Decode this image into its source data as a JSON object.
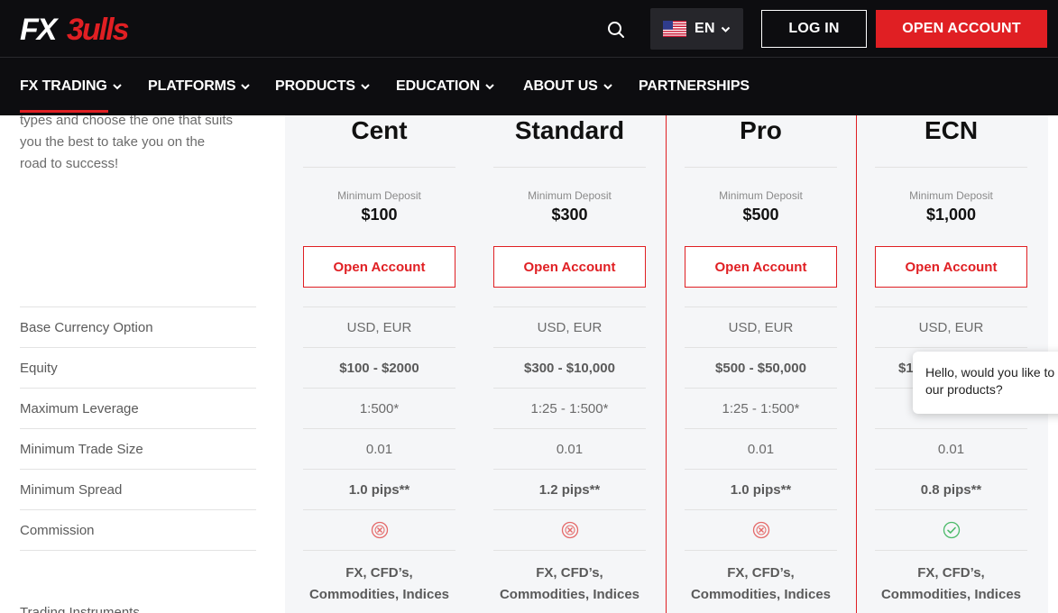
{
  "header": {
    "logo_text": "FX3ulls",
    "lang_code": "EN",
    "login_label": "LOG IN",
    "open_account_label": "OPEN ACCOUNT",
    "brand_color": "#e01f23"
  },
  "nav": {
    "items": [
      {
        "label": "FX TRADING"
      },
      {
        "label": "PLATFORMS"
      },
      {
        "label": "PRODUCTS"
      },
      {
        "label": "EDUCATION"
      },
      {
        "label": "ABOUT US"
      },
      {
        "label": "PARTNERSHIPS"
      }
    ]
  },
  "intro": {
    "line1": "types and choose the one that suits",
    "line2": "you the best to take you on the",
    "line3": "road to success!"
  },
  "rows": [
    {
      "label": "Base Currency Option"
    },
    {
      "label": "Equity"
    },
    {
      "label": "Maximum Leverage"
    },
    {
      "label": "Minimum Trade Size"
    },
    {
      "label": "Minimum Spread"
    },
    {
      "label": "Commission"
    },
    {
      "label": "Trading Instruments"
    }
  ],
  "accounts": [
    {
      "name": "Cent",
      "min_deposit_label": "Minimum Deposit",
      "min_deposit": "$100",
      "button": "Open Account",
      "currency": "USD, EUR",
      "equity": "$100 - $2000",
      "leverage": "1:500*",
      "trade_size": "0.01",
      "spread": "1.0 pips**",
      "commission_icon": "cross-icon",
      "instruments_1": "FX, CFD’s,",
      "instruments_2": "Commodities, Indices"
    },
    {
      "name": "Standard",
      "min_deposit_label": "Minimum Deposit",
      "min_deposit": "$300",
      "button": "Open Account",
      "currency": "USD, EUR",
      "equity": "$300 - $10,000",
      "leverage": "1:25 - 1:500*",
      "trade_size": "0.01",
      "spread": "1.2 pips**",
      "commission_icon": "cross-icon",
      "instruments_1": "FX, CFD’s,",
      "instruments_2": "Commodities, Indices"
    },
    {
      "name": "Pro",
      "min_deposit_label": "Minimum Deposit",
      "min_deposit": "$500",
      "button": "Open Account",
      "currency": "USD, EUR",
      "equity": "$500 - $50,000",
      "leverage": "1:25 - 1:500*",
      "trade_size": "0.01",
      "spread": "1.0 pips**",
      "commission_icon": "cross-icon",
      "instruments_1": "FX, CFD’s,",
      "instruments_2": "Commodities, Indices"
    },
    {
      "name": "ECN",
      "min_deposit_label": "Minimum Deposit",
      "min_deposit": "$1,000",
      "button": "Open Account",
      "currency": "USD, EUR",
      "equity": "$1",
      "leverage": "",
      "trade_size": "0.01",
      "spread": "0.8 pips**",
      "commission_icon": "check-icon",
      "instruments_1": "FX, CFD’s,",
      "instruments_2": "Commodities, Indices"
    }
  ],
  "chat": {
    "line1": "Hello, would you like to",
    "line2": "our products?"
  }
}
